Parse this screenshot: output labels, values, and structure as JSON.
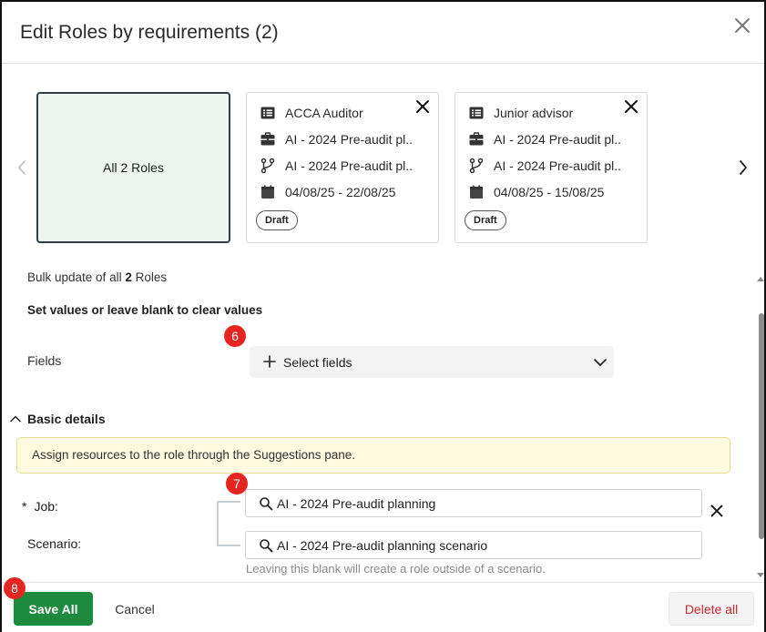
{
  "dialog": {
    "title": "Edit Roles by requirements (2)"
  },
  "carousel": {
    "all_label": "All 2 Roles",
    "cards": [
      {
        "name": "ACCA Auditor",
        "job": "AI - 2024 Pre-audit pl..",
        "scenario": "AI - 2024 Pre-audit pl..",
        "dates": "04/08/25 - 22/08/25",
        "status": "Draft"
      },
      {
        "name": "Junior advisor",
        "job": "AI - 2024 Pre-audit pl..",
        "scenario": "AI - 2024 Pre-audit pl..",
        "dates": "04/08/25 - 15/08/25",
        "status": "Draft"
      }
    ]
  },
  "bulk": {
    "prefix": "Bulk update of all",
    "count": "2",
    "suffix": "Roles",
    "instruction": "Set values or leave blank to clear values"
  },
  "steps": {
    "six": "6",
    "seven": "7",
    "eight": "8"
  },
  "fields": {
    "label": "Fields",
    "select_label": "Select fields"
  },
  "basic_details": {
    "heading": "Basic details",
    "banner": "Assign resources to the role through the Suggestions pane.",
    "required_mark": "*",
    "job_label": "Job:",
    "job_value": "AI - 2024 Pre-audit planning",
    "scenario_label": "Scenario:",
    "scenario_value": "AI - 2024 Pre-audit planning scenario",
    "hint": "Leaving this blank will create a role outside of a scenario."
  },
  "footer": {
    "save_all": "Save All",
    "cancel": "Cancel",
    "delete_all": "Delete all"
  },
  "colors": {
    "primary_green": "#1e8a3e",
    "danger_red": "#d2252f",
    "step_badge_red": "#e52521",
    "selected_card_bg": "#eef5f1",
    "banner_bg": "#fff9df"
  }
}
